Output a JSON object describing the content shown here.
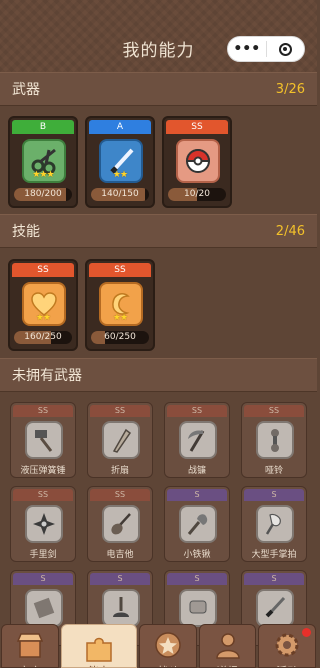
{
  "header": {
    "title": "我的能力",
    "menu_icon": "more-dots-icon",
    "close_icon": "target-icon"
  },
  "weapons_section": {
    "label": "武器",
    "count": "3/26"
  },
  "weapons": [
    {
      "grade": "B",
      "grade_color": "#3fae3a",
      "icon": "scissors-icon",
      "stars": "★★★",
      "progress": "180/200",
      "fill": 0.9
    },
    {
      "grade": "A",
      "grade_color": "#2f7fe0",
      "icon": "sword-icon",
      "stars": "★★",
      "progress": "140/150",
      "fill": 0.93
    },
    {
      "grade": "SS",
      "grade_color": "#e2562d",
      "icon": "pokeball-icon",
      "stars": "",
      "progress": "10/20",
      "fill": 0.5
    }
  ],
  "skills_section": {
    "label": "技能",
    "count": "2/46"
  },
  "skills": [
    {
      "grade": "SS",
      "icon": "heart-icon",
      "stars": "★★",
      "progress": "160/250",
      "fill": 0.64
    },
    {
      "grade": "SS",
      "icon": "crescent-icon",
      "stars": "★★",
      "progress": "60/250",
      "fill": 0.24
    }
  ],
  "unowned_section": {
    "label": "未拥有武器"
  },
  "unowned": [
    {
      "grade": "SS",
      "name": "液压弹簧锤",
      "icon": "hammer-icon"
    },
    {
      "grade": "SS",
      "name": "折扇",
      "icon": "folding-fan-icon"
    },
    {
      "grade": "SS",
      "name": "战镰",
      "icon": "scythe-icon"
    },
    {
      "grade": "SS",
      "name": "哑铃",
      "icon": "dumbbell-icon"
    },
    {
      "grade": "SS",
      "name": "手里剑",
      "icon": "shuriken-icon"
    },
    {
      "grade": "SS",
      "name": "电吉他",
      "icon": "guitar-icon"
    },
    {
      "grade": "S",
      "name": "小铁锹",
      "icon": "shovel-icon"
    },
    {
      "grade": "S",
      "name": "大型手掌拍",
      "icon": "palm-paddle-icon"
    },
    {
      "grade": "S",
      "name": "",
      "icon": "board-icon"
    },
    {
      "grade": "S",
      "name": "",
      "icon": "plunger-icon"
    },
    {
      "grade": "S",
      "name": "",
      "icon": "scroll-icon"
    },
    {
      "grade": "S",
      "name": "",
      "icon": "dagger-icon"
    }
  ],
  "tabs": [
    {
      "label": "商店",
      "icon": "shop-icon"
    },
    {
      "label": "能力",
      "icon": "puzzle-icon",
      "active": true
    },
    {
      "label": "战斗",
      "icon": "star-badge-icon"
    },
    {
      "label": "道场",
      "icon": "dojo-icon"
    },
    {
      "label": "活动",
      "icon": "gear-icon",
      "notification": true
    }
  ]
}
